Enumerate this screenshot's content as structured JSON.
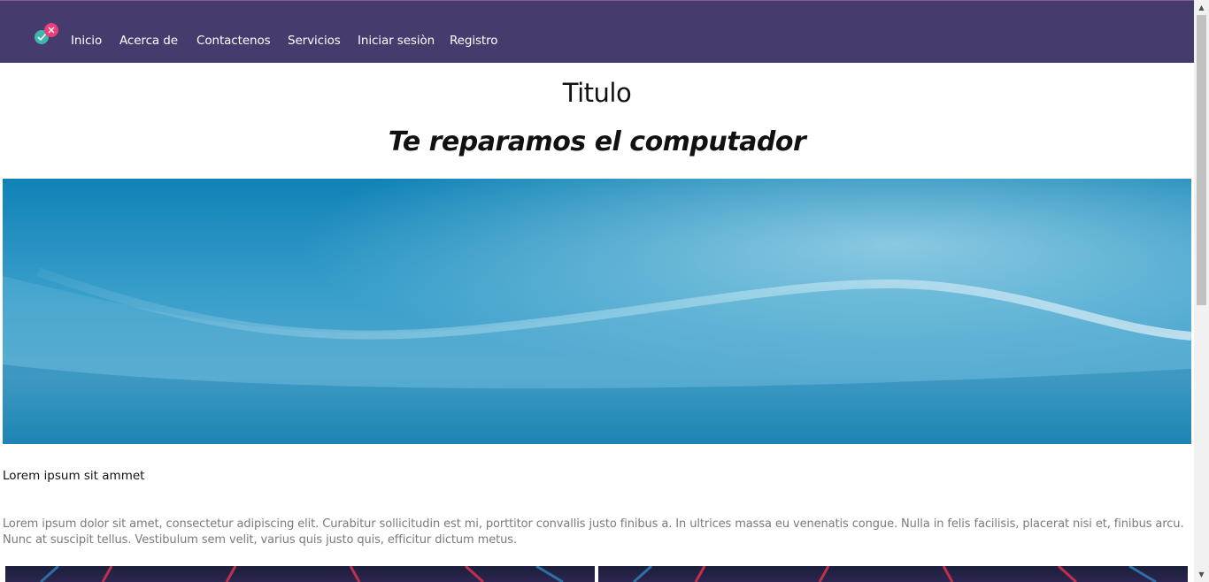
{
  "nav": {
    "links": [
      "Inicio",
      "Acerca de",
      "Contactenos",
      "Servicios",
      "Iniciar sesiòn",
      "Registro"
    ],
    "brand_color": "#463b6d"
  },
  "hero": {
    "title": "Titulo",
    "subtitle": "Te reparamos el computador"
  },
  "content": {
    "heading": "Lorem ipsum sit ammet",
    "paragraph": "Lorem ipsum dolor sit amet, consectetur adipiscing elit. Curabitur sollicitudin est mi, porttitor convallis justo finibus a. In ultrices massa eu venenatis congue. Nulla in felis facilisis, placerat nisi et, finibus arcu. Nunc at suscipit tellus. Vestibulum sem velit, varius quis justo quis, efficitur dictum metus."
  },
  "icons": {
    "logo": "logo-icon",
    "scroll_up": "chevron-up-icon",
    "scroll_down": "chevron-down-icon"
  }
}
